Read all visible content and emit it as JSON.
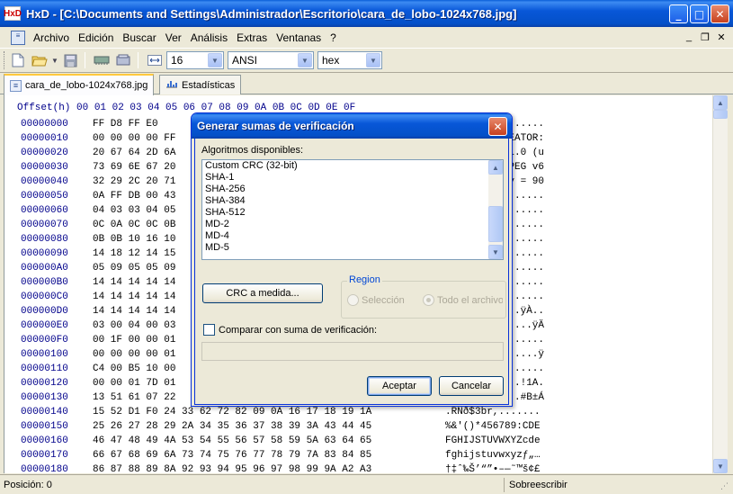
{
  "window": {
    "title": "HxD - [C:\\Documents and Settings\\Administrador\\Escritorio\\cara_de_lobo-1024x768.jpg]",
    "app_icon": "HxD",
    "minimize": "_",
    "maximize": "□",
    "close": "✕"
  },
  "menu": {
    "items": [
      "Archivo",
      "Edición",
      "Buscar",
      "Ver",
      "Análisis",
      "Extras",
      "Ventanas",
      "?"
    ],
    "mdi_minimize": "_",
    "mdi_restore": "❐",
    "mdi_close": "✕"
  },
  "toolbar": {
    "bytes_per_row": "16",
    "charset": "ANSI",
    "offset_base": "hex"
  },
  "tabs": [
    {
      "label": "cara_de_lobo-1024x768.jpg",
      "icon": "document-icon",
      "active": true
    },
    {
      "label": "Estadísticas",
      "icon": "chart-icon",
      "active": false
    }
  ],
  "hex": {
    "header": "Offset(h) 00 01 02 03 04 05 06 07 08 09 0A 0B 0C 0D 0E 0F",
    "rows": [
      {
        "offset": "00000000",
        "bytes": "FF D8 FF E0",
        "ascii": "......"
      },
      {
        "offset": "00000010",
        "bytes": "00 00 00 00 FF",
        "ascii": "REATOR:"
      },
      {
        "offset": "00000020",
        "bytes": "20 67 64 2D 6A",
        "ascii": "1.0 (u"
      },
      {
        "offset": "00000030",
        "bytes": "73 69 6E 67 20",
        "ascii": "PEG v6"
      },
      {
        "offset": "00000040",
        "bytes": "32 29 2C 20 71",
        "ascii": "y = 90"
      },
      {
        "offset": "00000050",
        "bytes": "0A FF DB 00 43",
        "ascii": "....."
      },
      {
        "offset": "00000060",
        "bytes": "04 03 03 04 05",
        "ascii": "....."
      },
      {
        "offset": "00000070",
        "bytes": "0C 0A 0C 0C 0B",
        "ascii": "....."
      },
      {
        "offset": "00000080",
        "bytes": "0B 0B 10 16 10",
        "ascii": "....."
      },
      {
        "offset": "00000090",
        "bytes": "14 18 12 14 15",
        "ascii": "....."
      },
      {
        "offset": "000000A0",
        "bytes": "05 09 05 05 09",
        "ascii": "....."
      },
      {
        "offset": "000000B0",
        "bytes": "14 14 14 14 14",
        "ascii": "....."
      },
      {
        "offset": "000000C0",
        "bytes": "14 14 14 14 14",
        "ascii": "....."
      },
      {
        "offset": "000000D0",
        "bytes": "14 14 14 14 14",
        "ascii": ".ÿÀ.."
      },
      {
        "offset": "000000E0",
        "bytes": "03 00 04 00 03",
        "ascii": "....ÿÄ"
      },
      {
        "offset": "000000F0",
        "bytes": "00 1F 00 00 01",
        "ascii": "....."
      },
      {
        "offset": "00000100",
        "bytes": "00 00 00 00 01",
        "ascii": "....ÿ"
      },
      {
        "offset": "00000110",
        "bytes": "C4 00 B5 10 00",
        "ascii": "....."
      },
      {
        "offset": "00000120",
        "bytes": "00 00 01 7D 01",
        "ascii": "..!1A."
      },
      {
        "offset": "00000130",
        "bytes": "13 51 61 07 22",
        "ascii": "¡.#B±Á"
      },
      {
        "offset": "00000140",
        "bytes": "15 52 D1 F0 24 33 62 72 82 09 0A 16 17 18 19 1A",
        "ascii": ".RÑð$3br,......."
      },
      {
        "offset": "00000150",
        "bytes": "25 26 27 28 29 2A 34 35 36 37 38 39 3A 43 44 45",
        "ascii": "%&'()*456789:CDE"
      },
      {
        "offset": "00000160",
        "bytes": "46 47 48 49 4A 53 54 55 56 57 58 59 5A 63 64 65",
        "ascii": "FGHIJSTUVWXYZcde"
      },
      {
        "offset": "00000170",
        "bytes": "66 67 68 69 6A 73 74 75 76 77 78 79 7A 83 84 85",
        "ascii": "fghijstuvwxyzƒ„…"
      },
      {
        "offset": "00000180",
        "bytes": "86 87 88 89 8A 92 93 94 95 96 97 98 99 9A A2 A3",
        "ascii": "†‡ˆ‰Š’“”•–—˜™š¢£"
      }
    ]
  },
  "status": {
    "position": "Posición: 0",
    "mode": "Sobreescribir"
  },
  "dialog": {
    "title": "Generar sumas de verificación",
    "close": "✕",
    "algorithms_label": "Algoritmos disponibles:",
    "algorithms": [
      "Custom CRC (32-bit)",
      "SHA-1",
      "SHA-256",
      "SHA-384",
      "SHA-512",
      "MD-2",
      "MD-4",
      "MD-5"
    ],
    "crc_button": "CRC a medida...",
    "region_label": "Region",
    "region_selection": "Selección",
    "region_whole": "Todo el archivo",
    "compare_label": "Comparar con suma de verificación:",
    "compare_value": "",
    "ok_button": "Aceptar",
    "cancel_button": "Cancelar"
  }
}
